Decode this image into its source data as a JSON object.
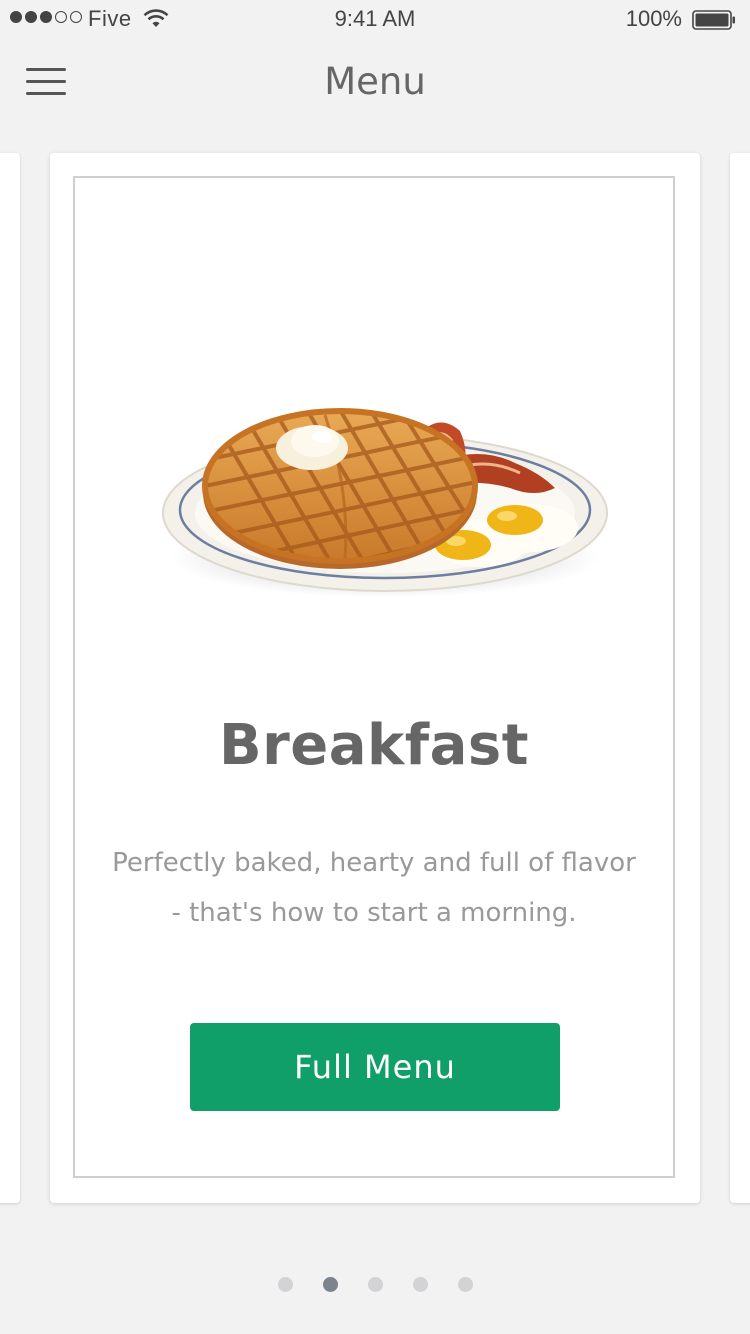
{
  "status_bar": {
    "carrier": "Five",
    "time": "9:41 AM",
    "battery_percent": "100%",
    "signal_bars_filled": 3,
    "signal_bars_total": 5,
    "battery_level": 1.0
  },
  "nav": {
    "title": "Menu",
    "menu_icon": "hamburger-icon"
  },
  "card": {
    "image": "breakfast-plate-waffle-bacon-eggs",
    "title": "Breakfast",
    "description_line1": "Perfectly baked, hearty and full of flavor",
    "description_line2": "-  that's how to start a morning.",
    "button_label": "Full Menu"
  },
  "pager": {
    "total": 5,
    "active_index": 1
  },
  "colors": {
    "background": "#f2f2f2",
    "accent": "#109f68",
    "title_text": "#666666",
    "body_text": "#999999",
    "pager_active": "#7d848e",
    "pager_inactive": "#d3d3d6"
  }
}
